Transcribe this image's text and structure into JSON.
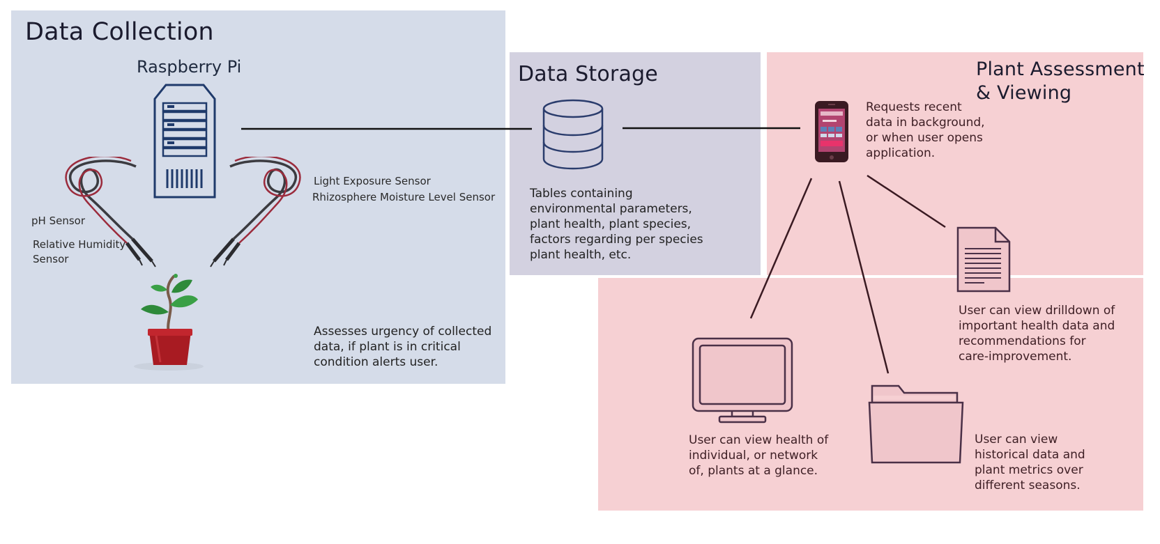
{
  "colors": {
    "collection_bg": "#d5dce9",
    "storage_bg": "#d3d1e0",
    "assessment_bg": "#f6d0d3",
    "server_blue": "#1f3a6b",
    "database_blue": "#2a3c6c",
    "icon_outline": "#4a3047",
    "icon_fill": "#f0c6cb",
    "connector": "#111111",
    "connector_dark": "#3a1a22"
  },
  "icons": {
    "server": "raspberry-pi-server-icon",
    "database": "database-icon",
    "phone": "smartphone-icon",
    "document": "document-icon",
    "monitor": "monitor-icon",
    "folder": "folder-icon",
    "plant": "potted-plant-icon",
    "probe": "sensor-probe-icon"
  },
  "data_collection": {
    "title": "Data Collection",
    "device": "Raspberry Pi",
    "sensor_light": "Light Exposure Sensor",
    "sensor_moisture": "Rhizosphere Moisture Level Sensor",
    "sensor_ph": "pH Sensor",
    "sensor_humidity": "Relative Humidity\nSensor",
    "description": "Assesses urgency of collected\ndata, if plant is in critical\ncondition alerts user."
  },
  "data_storage": {
    "title": "Data Storage",
    "description": "Tables containing\nenvironmental parameters,\nplant health, plant species,\nfactors regarding per species\nplant health, etc."
  },
  "plant_assessment": {
    "title": "Plant Assessment\n& Viewing",
    "phone_description": "Requests recent\ndata in background,\nor when user opens\napplication.",
    "document_description": "User can view drilldown of\nimportant health data and\nrecommendations for\ncare-improvement.",
    "monitor_description": "User can view health of\nindividual, or network\nof, plants at a glance.",
    "folder_description": "User can view\nhistorical data and\nplant metrics over\ndifferent seasons."
  }
}
